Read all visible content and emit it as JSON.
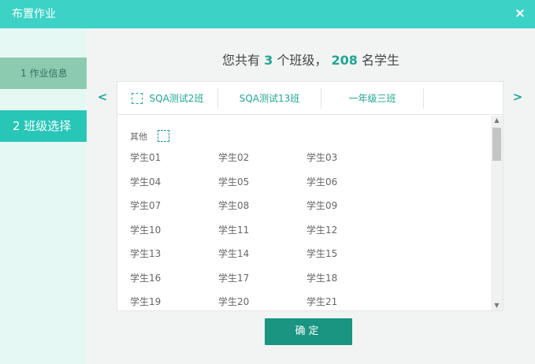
{
  "dialog": {
    "title": "布置作业",
    "close_icon": "close-icon",
    "close_glyph": "×"
  },
  "sidebar": {
    "steps": [
      {
        "label": "1 作业信息",
        "state": "completed"
      },
      {
        "label": "2 班级选择",
        "state": "active"
      }
    ]
  },
  "summary": {
    "prefix": "您共有",
    "class_count": "3",
    "middle": "个班级，",
    "student_count": "208",
    "suffix": "名学生"
  },
  "nav": {
    "prev_glyph": "<",
    "next_glyph": ">"
  },
  "tabs": [
    {
      "label": "SQA测试2班",
      "has_checkbox": true
    },
    {
      "label": "SQA测试13班",
      "has_checkbox": false
    },
    {
      "label": "一年级三班",
      "has_checkbox": false
    }
  ],
  "group": {
    "label": "其他"
  },
  "students": [
    "学生01",
    "学生02",
    "学生03",
    "学生04",
    "学生05",
    "学生06",
    "学生07",
    "学生08",
    "学生09",
    "学生10",
    "学生11",
    "学生12",
    "学生13",
    "学生14",
    "学生15",
    "学生16",
    "学生17",
    "学生18",
    "学生19",
    "学生20",
    "学生21"
  ],
  "scrollbar": {
    "up_glyph": "▲",
    "down_glyph": "▼"
  },
  "confirm_label": "确定",
  "colors": {
    "header": "#3cd2c6",
    "accent": "#1fa595",
    "active_step": "#27c6b7",
    "done_step": "#8ccbb0",
    "confirm_button": "#1a9582"
  }
}
